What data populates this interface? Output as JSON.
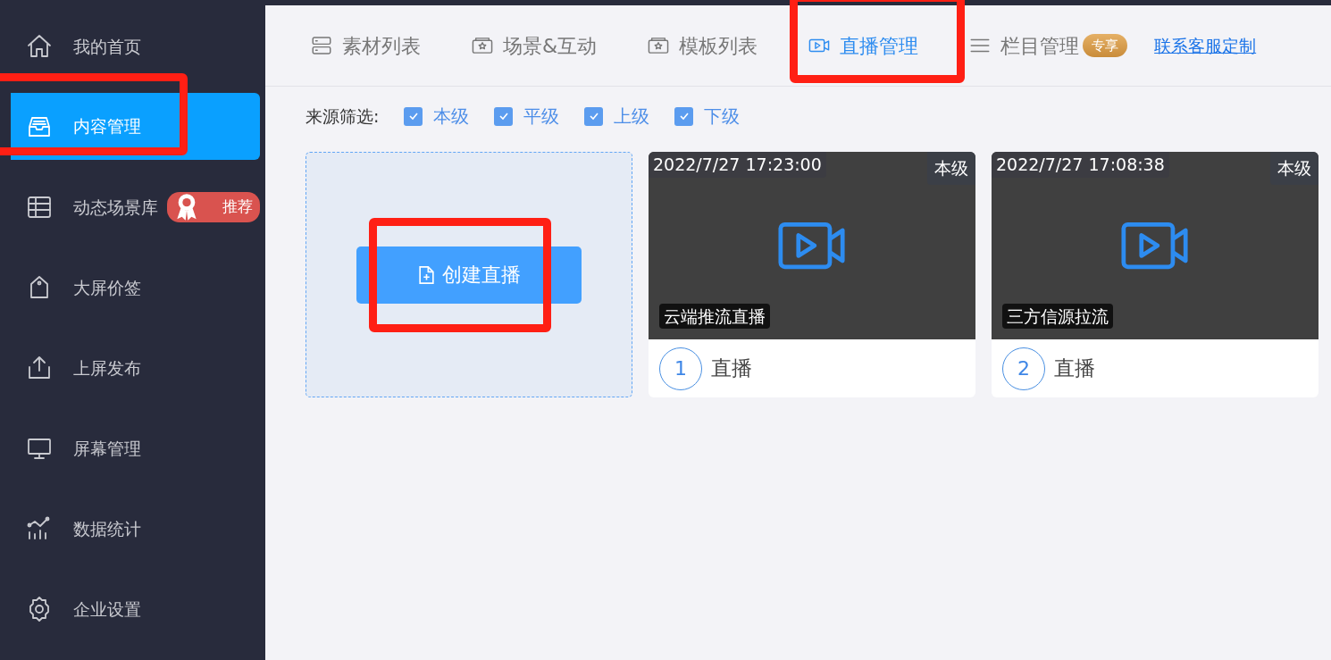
{
  "sidebar": {
    "items": [
      {
        "label": "我的首页",
        "selected": false,
        "highlighted": false
      },
      {
        "label": "内容管理",
        "selected": true,
        "highlighted": true
      },
      {
        "label": "动态场景库",
        "selected": false,
        "highlighted": false,
        "badge": "推荐"
      },
      {
        "label": "大屏价签",
        "selected": false,
        "highlighted": false
      },
      {
        "label": "上屏发布",
        "selected": false,
        "highlighted": false
      },
      {
        "label": "屏幕管理",
        "selected": false,
        "highlighted": false
      },
      {
        "label": "数据统计",
        "selected": false,
        "highlighted": false
      },
      {
        "label": "企业设置",
        "selected": false,
        "highlighted": false
      }
    ]
  },
  "tabs": [
    {
      "label": "素材列表",
      "selected": false,
      "highlighted": false
    },
    {
      "label": "场景&互动",
      "selected": false,
      "highlighted": false
    },
    {
      "label": "模板列表",
      "selected": false,
      "highlighted": false
    },
    {
      "label": "直播管理",
      "selected": true,
      "highlighted": true
    },
    {
      "label": "栏目管理",
      "selected": false,
      "highlighted": false,
      "badge": "专享"
    }
  ],
  "contact_link": "联系客服定制",
  "filter": {
    "label": "来源筛选:",
    "options": [
      {
        "label": "本级",
        "checked": true
      },
      {
        "label": "平级",
        "checked": true
      },
      {
        "label": "上级",
        "checked": true
      },
      {
        "label": "下级",
        "checked": true
      }
    ]
  },
  "create_button": {
    "label": "创建直播",
    "highlighted": true
  },
  "streams": [
    {
      "time": "2022/7/27 17:23:00",
      "level": "本级",
      "type": "云端推流直播",
      "index": "1",
      "title": "直播"
    },
    {
      "time": "2022/7/27 17:08:38",
      "level": "本级",
      "type": "三方信源拉流",
      "index": "2",
      "title": "直播"
    }
  ]
}
